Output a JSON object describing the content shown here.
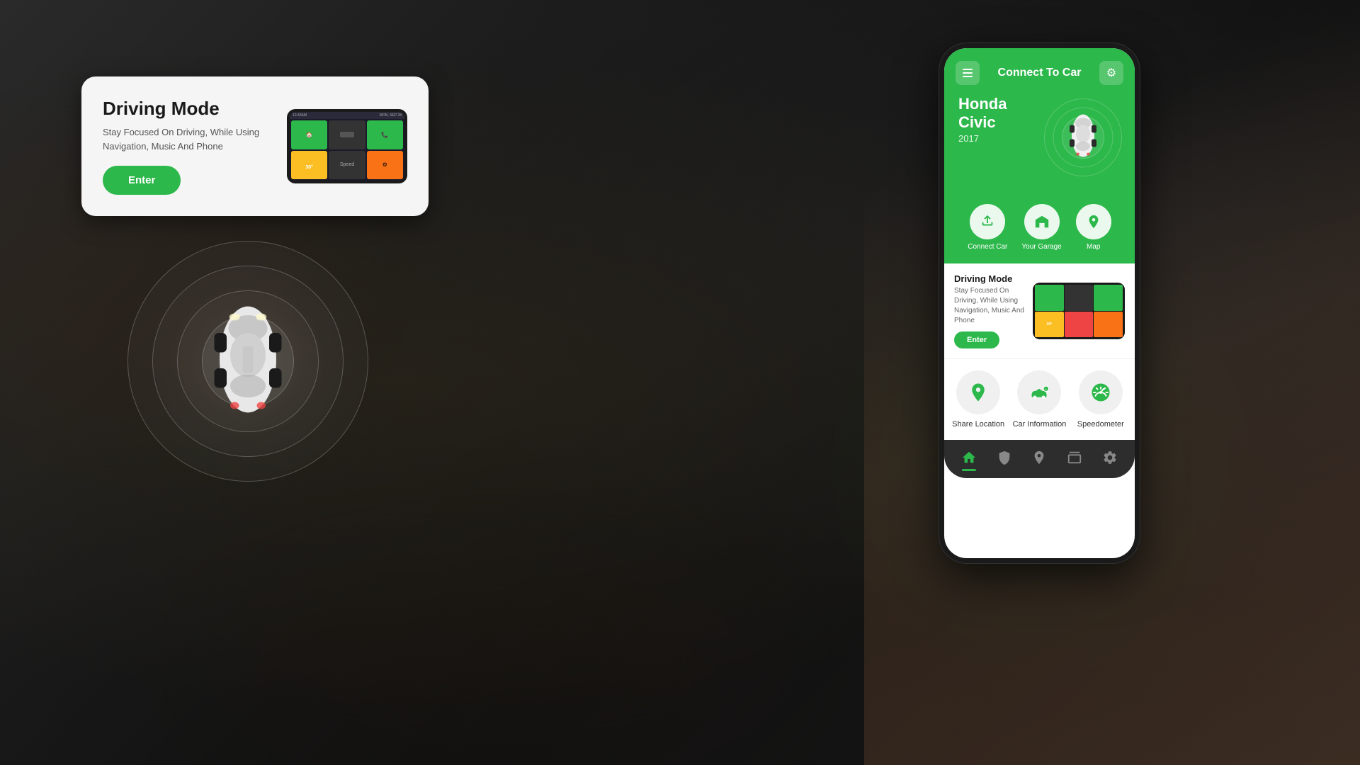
{
  "background": {
    "color": "#1a1a1a"
  },
  "driving_mode_card": {
    "title": "Driving Mode",
    "description": "Stay Focused On Driving, While Using Navigation, Music And Phone",
    "enter_button_label": "Enter"
  },
  "car_section": {
    "radar_rings": [
      200,
      160,
      120,
      80
    ]
  },
  "phone": {
    "header": {
      "title": "Connect To Car",
      "menu_icon": "≡",
      "settings_icon": "⚙"
    },
    "car_info": {
      "name": "Honda Civic",
      "year": "2017"
    },
    "green_nav_icons": [
      {
        "label": "Connect Car",
        "icon": "🔗"
      },
      {
        "label": "Your Garage",
        "icon": "🏠"
      },
      {
        "label": "Map",
        "icon": "📍"
      }
    ],
    "driving_mode": {
      "title": "Driving Mode",
      "description": "Stay Focused On Driving, While Using Navigation, Music And Phone",
      "enter_button_label": "Enter"
    },
    "grid_icons": [
      {
        "label": "Share Location",
        "icon": "📍"
      },
      {
        "label": "Car Information",
        "icon": "🚗"
      },
      {
        "label": "Speedometer",
        "icon": "⏱"
      }
    ],
    "bottom_nav": [
      {
        "label": "home",
        "icon": "🏠",
        "active": true
      },
      {
        "label": "shield",
        "icon": "🛡",
        "active": false
      },
      {
        "label": "location",
        "icon": "📍",
        "active": false
      },
      {
        "label": "box",
        "icon": "📦",
        "active": false
      },
      {
        "label": "settings",
        "icon": "⚙",
        "active": false
      }
    ]
  }
}
